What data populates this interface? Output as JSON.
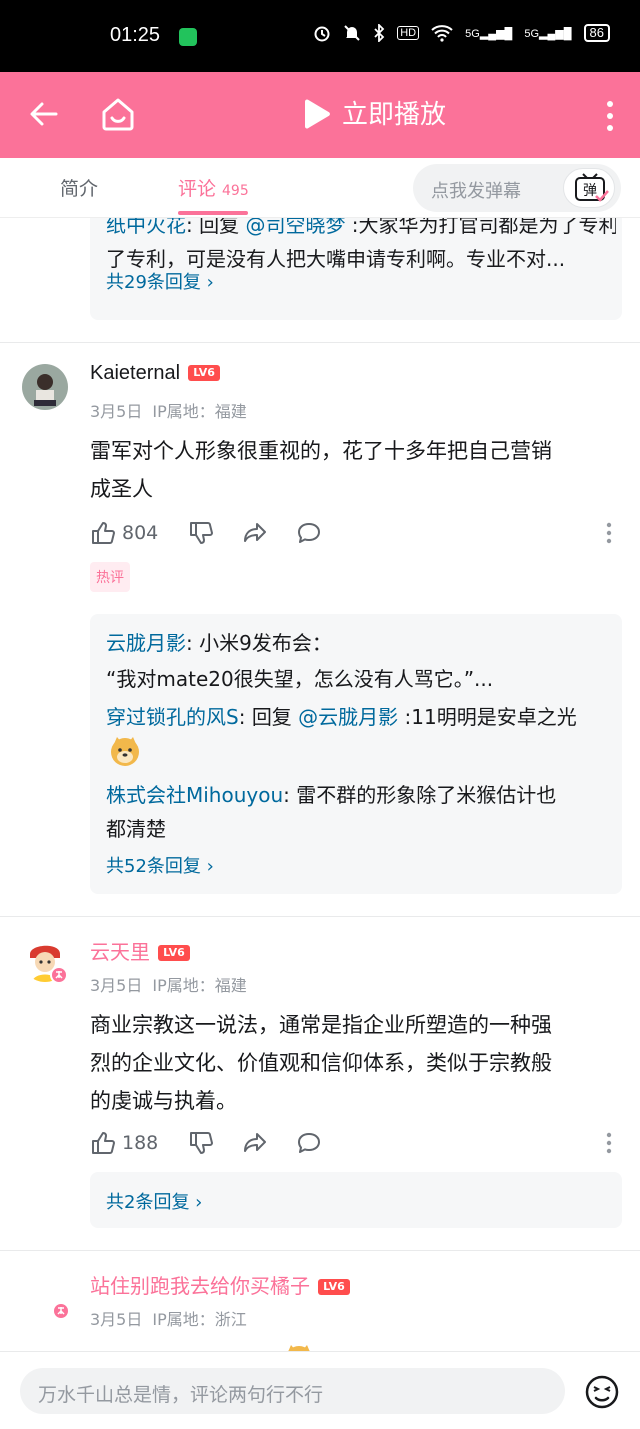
{
  "status_bar": {
    "time": "01:25",
    "signal_1": "5G",
    "signal_2": "5G",
    "hd": "HD",
    "battery": "86"
  },
  "app_bar": {
    "play_label": "立即播放",
    "icons": [
      "back-arrow-icon",
      "home-icon",
      "play-icon",
      "more-vertical-icon"
    ]
  },
  "tabs": {
    "intro": "简介",
    "comments": "评论",
    "comments_count": "495",
    "danmaku_placeholder": "点我发弹幕",
    "danmaku_icon_text": "弹"
  },
  "colors": {
    "accent": "#fb7299",
    "link": "#00699d",
    "level_badge": "#ff4d4d"
  },
  "top_partial": {
    "reply_user": "纸中火花",
    "reply_prefix": ": 回复 ",
    "reply_mention": "@司空晓梦",
    "reply_text": " :大家华为打官司都是为了专利，可是没有人把大嘴申请专利啊。专业不对...",
    "reply_text_line2": "了专利，可是没有人把大嘴申请专利啊。专业不对...",
    "more_replies": "共29条回复"
  },
  "comments": [
    {
      "username": "Kaieternal",
      "level": "LV6",
      "date": "3月5日",
      "ip": "IP属地：福建",
      "content_line1": "雷军对个人形象很重视的，花了十多年把自己营销",
      "content_line2": "成圣人",
      "likes": "804",
      "tag": "热评",
      "replies": [
        {
          "user": "云胧月影",
          "sep": ": ",
          "text": "小米9发布会：",
          "text2": "“我对mate20很失望，怎么没有人骂它。”..."
        },
        {
          "user": "穿过锁孔的风S",
          "sep": ": ",
          "prefix": "回复 ",
          "mention": "@云胧月影",
          "text": " :11明明是安卓之光"
        },
        {
          "user": "株式会社Mihouyou",
          "sep": ": ",
          "text": "雷不群的形象除了米猴估计也",
          "text2": "都清楚"
        }
      ],
      "more_replies": "共52条回复"
    },
    {
      "username": "云天里",
      "level": "LV6",
      "date": "3月5日",
      "ip": "IP属地：福建",
      "content_line1": "商业宗教这一说法，通常是指企业所塑造的一种强",
      "content_line2": "烈的企业文化、价值观和信仰体系，类似于宗教般",
      "content_line3": "的虔诚与执着。",
      "likes": "188",
      "more_replies": "共2条回复"
    },
    {
      "username": "站住别跑我去给你买橘子",
      "level": "LV6",
      "date": "3月5日",
      "ip": "IP属地：浙江"
    }
  ],
  "bottom_bar": {
    "placeholder": "万水千山总是情，评论两句行不行"
  }
}
